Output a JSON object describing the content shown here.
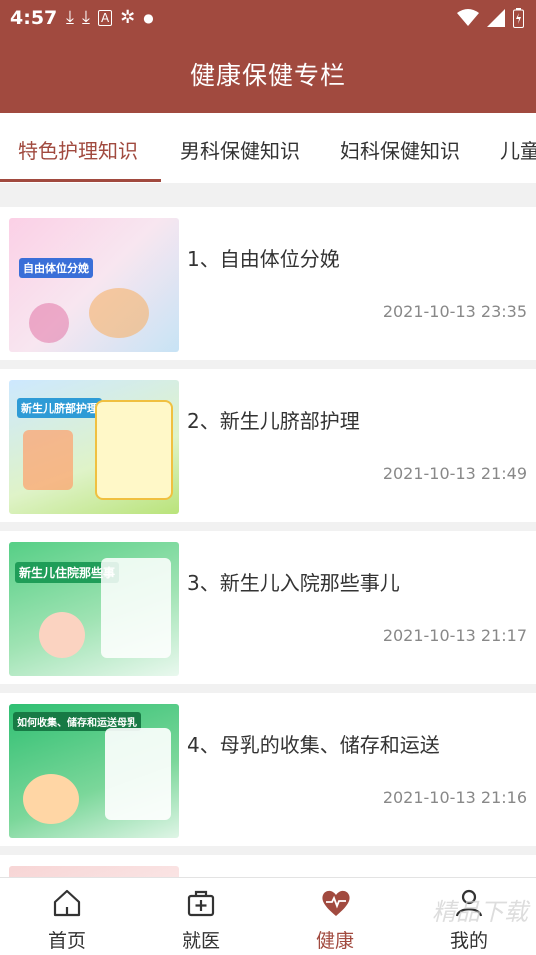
{
  "status": {
    "time": "4:57",
    "icons": [
      "download-icon",
      "download-icon",
      "a-icon",
      "bug-icon",
      "dot-icon"
    ],
    "right_icons": [
      "wifi-icon",
      "signal-icon",
      "battery-icon"
    ]
  },
  "header": {
    "title": "健康保健专栏"
  },
  "tabs": [
    {
      "label": "特色护理知识",
      "active": true
    },
    {
      "label": "男科保健知识",
      "active": false
    },
    {
      "label": "妇科保健知识",
      "active": false
    },
    {
      "label": "儿童",
      "active": false
    }
  ],
  "articles": [
    {
      "title": "1、自由体位分娩",
      "time": "2021-10-13 23:35",
      "thumb_text": "自由体位分娩"
    },
    {
      "title": "2、新生儿脐部护理",
      "time": "2021-10-13 21:49",
      "thumb_text": "新生儿脐部护理"
    },
    {
      "title": "3、新生儿入院那些事儿",
      "time": "2021-10-13 21:17",
      "thumb_text": "新生儿住院那些事"
    },
    {
      "title": "4、母乳的收集、储存和运送",
      "time": "2021-10-13 21:16",
      "thumb_text": "如何收集、储存和运送母乳"
    }
  ],
  "nav": [
    {
      "label": "首页",
      "icon": "home-icon",
      "active": false
    },
    {
      "label": "就医",
      "icon": "medical-kit-icon",
      "active": false
    },
    {
      "label": "健康",
      "icon": "heart-pulse-icon",
      "active": true
    },
    {
      "label": "我的",
      "icon": "user-icon",
      "active": false
    }
  ],
  "colors": {
    "brand": "#a14a3f",
    "text": "#333333",
    "muted": "#888888"
  },
  "watermark": "精品下载"
}
